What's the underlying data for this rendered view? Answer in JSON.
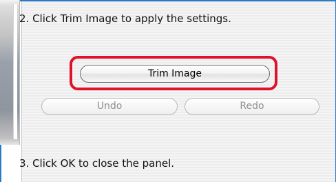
{
  "instructions": {
    "step2": "2. Click Trim Image to apply the settings.",
    "step3": "3. Click OK to close the panel."
  },
  "buttons": {
    "trim_image": "Trim Image",
    "undo": "Undo",
    "redo": "Redo"
  },
  "highlight_color": "#e0112b",
  "accent_color": "#2a79c6"
}
